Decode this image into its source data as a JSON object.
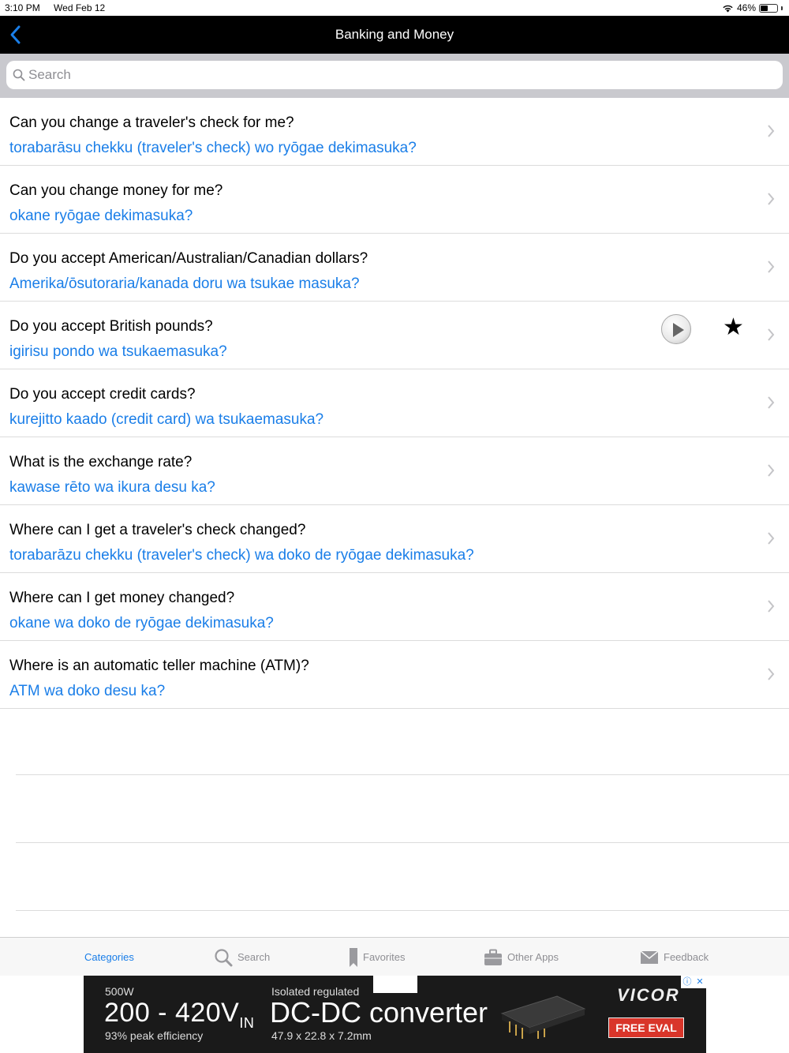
{
  "status_bar": {
    "time": "3:10 PM",
    "date": "Wed Feb 12",
    "battery": "46%",
    "battery_level": 0.46
  },
  "nav": {
    "title": "Banking and Money"
  },
  "search": {
    "placeholder": "Search"
  },
  "phrases": [
    {
      "english": "Can you change a traveler's check for me?",
      "translit": "torabarāsu chekku (traveler's check) wo ryōgae dekimasuka?"
    },
    {
      "english": "Can you change money for me?",
      "translit": "okane ryōgae dekimasuka?"
    },
    {
      "english": "Do you accept American/Australian/Canadian dollars?",
      "translit": "Amerika/ōsutoraria/kanada doru wa tsukae masuka?"
    },
    {
      "english": "Do you accept British pounds?",
      "translit": "igirisu pondo wa tsukaemasuka?"
    },
    {
      "english": "Do you accept credit cards?",
      "translit": "kurejitto kaado (credit card) wa tsukaemasuka?"
    },
    {
      "english": "What is the exchange rate?",
      "translit": "kawase rēto wa ikura desu ka?"
    },
    {
      "english": "Where can I get a traveler's check changed?",
      "translit": "torabarāzu chekku (traveler's check) wa doko de ryōgae dekimasuka?"
    },
    {
      "english": "Where can I get money changed?",
      "translit": "okane wa doko de ryōgae dekimasuka?"
    },
    {
      "english": "Where is an automatic teller machine (ATM)?",
      "translit": "ATM wa doko desu ka?"
    }
  ],
  "row_actions": {
    "star": "★"
  },
  "tabs": [
    {
      "label": "Categories",
      "icon": "categories-icon",
      "active": true
    },
    {
      "label": "Search",
      "icon": "search-icon",
      "active": false
    },
    {
      "label": "Favorites",
      "icon": "bookmark-icon",
      "active": false
    },
    {
      "label": "Other Apps",
      "icon": "briefcase-icon",
      "active": false
    },
    {
      "label": "Feedback",
      "icon": "envelope-icon",
      "active": false
    }
  ],
  "ad": {
    "watt": "500W",
    "range_main": "200 - 420V",
    "range_sub": "IN",
    "efficiency": "93% peak efficiency",
    "isolated": "Isolated regulated",
    "converter": "DC-DC converter",
    "dims": "47.9 x 22.8 x 7.2mm",
    "brand": "VICOR",
    "cta": "FREE EVAL",
    "info_glyph": "ⓘ",
    "close_glyph": "✕"
  },
  "colors": {
    "accent": "#1a7ee8",
    "nav_bg": "#000000",
    "search_bg": "#c9c9ce",
    "ad_cta": "#d9352a"
  }
}
